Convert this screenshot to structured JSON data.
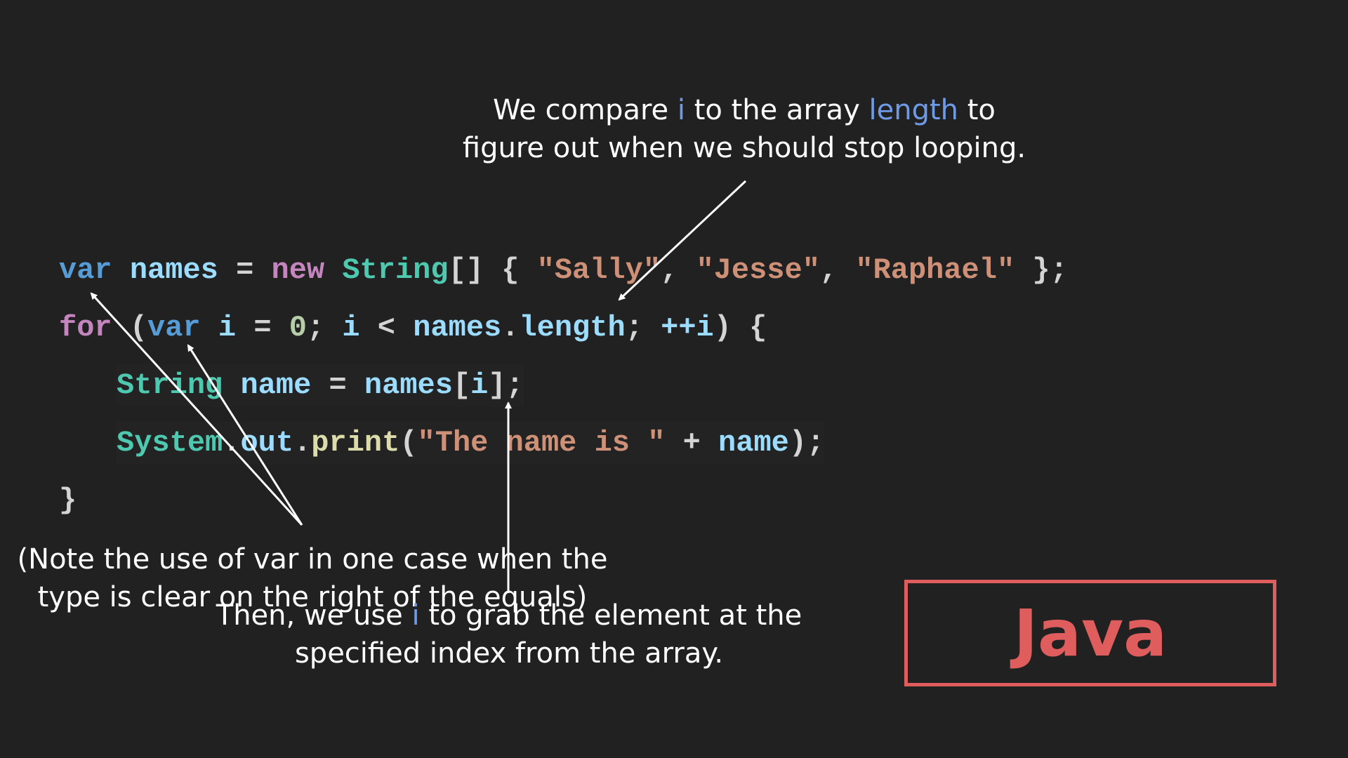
{
  "annotations": {
    "compare": {
      "prefix": "We compare ",
      "var": "i",
      "mid": " to the array ",
      "prop": "length",
      "suffix": " to",
      "line2": "figure out when we should stop looping."
    },
    "index": {
      "prefix": "Then, we use ",
      "var": "i",
      "suffix": " to grab the element at the",
      "line2": "specified index from the array."
    },
    "var_note": {
      "line1": "(Note the use of var in one case when the",
      "line2": "type is clear on the right of the equals)"
    }
  },
  "code": {
    "line1": {
      "kw": "var",
      "name": "names",
      "eq": " = ",
      "new": "new",
      "type": "String",
      "brackets": "[] { ",
      "s1": "\"Sally\"",
      "c1": ", ",
      "s2": "\"Jesse\"",
      "c2": ", ",
      "s3": "\"Raphael\"",
      "end": " };"
    },
    "line2": {
      "for": "for",
      "p1": " (",
      "var": "var",
      "i1": "i",
      "eq": " = ",
      "zero": "0",
      "semi1": "; ",
      "i2": "i",
      "lt": " < ",
      "names": "names",
      "dot": ".",
      "length": "length",
      "semi2": "; ",
      "inc": "++i",
      "end": ") {"
    },
    "line3": {
      "type": "String",
      "name": "name",
      "eq": " = ",
      "names": "names",
      "open": "[",
      "i": "i",
      "close": "];"
    },
    "line4": {
      "system": "System",
      "dot1": ".",
      "out": "out",
      "dot2": ".",
      "print": "print",
      "open": "(",
      "str": "\"The name is \"",
      "plus": " + ",
      "name": "name",
      "close": ");"
    },
    "line5": "}"
  },
  "language_badge": {
    "label": "Java",
    "color": "#e05d5d"
  },
  "colors": {
    "background": "#212121",
    "highlight": "#6f9be6",
    "keyword": "#569cd6",
    "control": "#c586c0",
    "type": "#4ec9b0",
    "identifier": "#9cdcfe",
    "string": "#ce9178",
    "number": "#b5cea8",
    "function": "#dcdcaa"
  }
}
